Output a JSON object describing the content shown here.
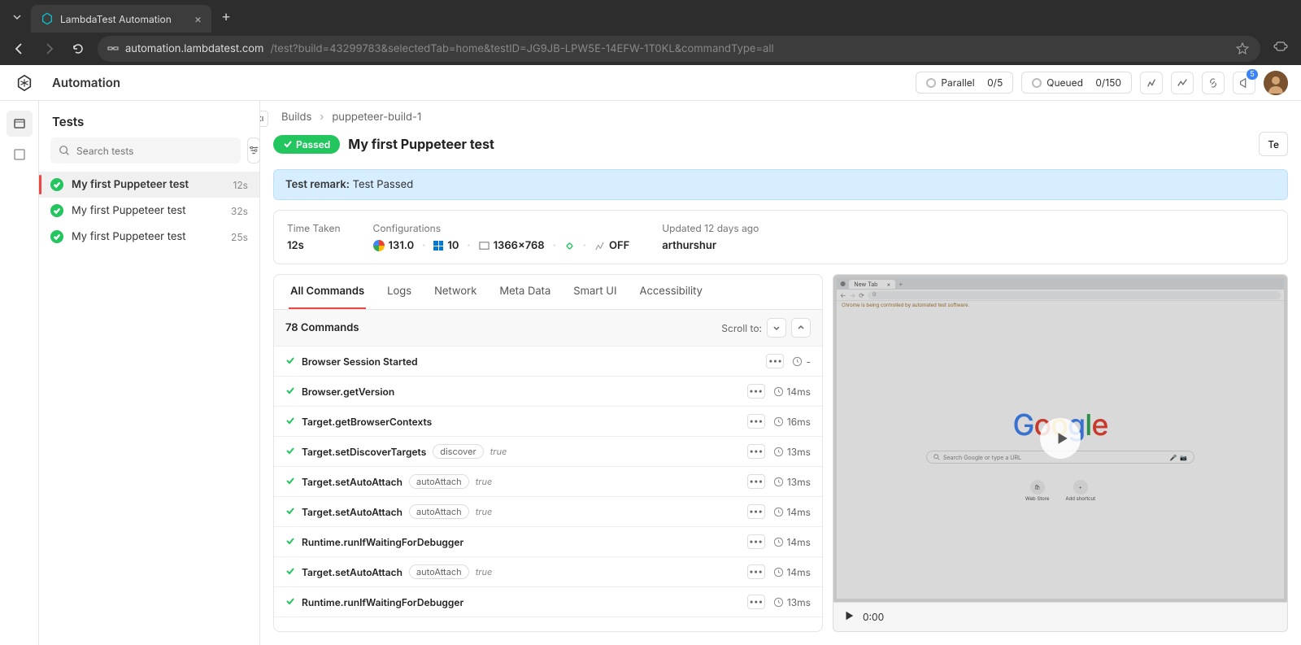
{
  "browser": {
    "tab_title": "LambdaTest Automation",
    "url_host": "automation.lambdatest.com",
    "url_path": "/test?build=43299783&selectedTab=home&testID=JG9JB-LPW5E-14EFW-1T0KL&commandType=all"
  },
  "header": {
    "page_title": "Automation",
    "parallel": {
      "label": "Parallel",
      "value": "0/5"
    },
    "queued": {
      "label": "Queued",
      "value": "0/150"
    },
    "notif_count": "5"
  },
  "tests_panel": {
    "title": "Tests",
    "search_placeholder": "Search tests",
    "items": [
      {
        "name": "My first Puppeteer test",
        "time": "12s",
        "selected": true
      },
      {
        "name": "My first Puppeteer test",
        "time": "32s",
        "selected": false
      },
      {
        "name": "My first Puppeteer test",
        "time": "25s",
        "selected": false
      }
    ]
  },
  "breadcrumb": {
    "root": "Builds",
    "current": "puppeteer-build-1"
  },
  "detail": {
    "status": "Passed",
    "title": "My first Puppeteer test",
    "action_btn": "Te",
    "remark_label": "Test remark:",
    "remark_value": "Test Passed"
  },
  "info": {
    "time_taken": {
      "label": "Time Taken",
      "value": "12s"
    },
    "config": {
      "label": "Configurations",
      "browser_ver": "131.0",
      "os_ver": "10",
      "resolution": "1366x768",
      "tunnel": "OFF"
    },
    "updated": {
      "label": "Updated 12 days ago",
      "user": "arthurshur"
    }
  },
  "cmd_panel": {
    "tabs": [
      "All Commands",
      "Logs",
      "Network",
      "Meta Data",
      "Smart UI",
      "Accessibility"
    ],
    "count_label": "78 Commands",
    "scroll_label": "Scroll to:",
    "commands": [
      {
        "name": "Browser Session Started",
        "pill": null,
        "arg": null,
        "dur": "-"
      },
      {
        "name": "Browser.getVersion",
        "pill": null,
        "arg": null,
        "dur": "14ms"
      },
      {
        "name": "Target.getBrowserContexts",
        "pill": null,
        "arg": null,
        "dur": "16ms"
      },
      {
        "name": "Target.setDiscoverTargets",
        "pill": "discover",
        "arg": "true",
        "dur": "13ms"
      },
      {
        "name": "Target.setAutoAttach",
        "pill": "autoAttach",
        "arg": "true",
        "dur": "13ms"
      },
      {
        "name": "Target.setAutoAttach",
        "pill": "autoAttach",
        "arg": "true",
        "dur": "14ms"
      },
      {
        "name": "Runtime.runIfWaitingForDebugger",
        "pill": null,
        "arg": null,
        "dur": "14ms"
      },
      {
        "name": "Target.setAutoAttach",
        "pill": "autoAttach",
        "arg": "true",
        "dur": "14ms"
      },
      {
        "name": "Runtime.runIfWaitingForDebugger",
        "pill": null,
        "arg": null,
        "dur": "13ms"
      }
    ]
  },
  "video": {
    "time": "0:00",
    "sim_tab": "New Tab",
    "sim_info": "Chrome is being controlled by automated test software.",
    "sim_search_ph": "Search Google or type a URL",
    "shortcuts": [
      "Web Store",
      "Add shortcut"
    ]
  }
}
